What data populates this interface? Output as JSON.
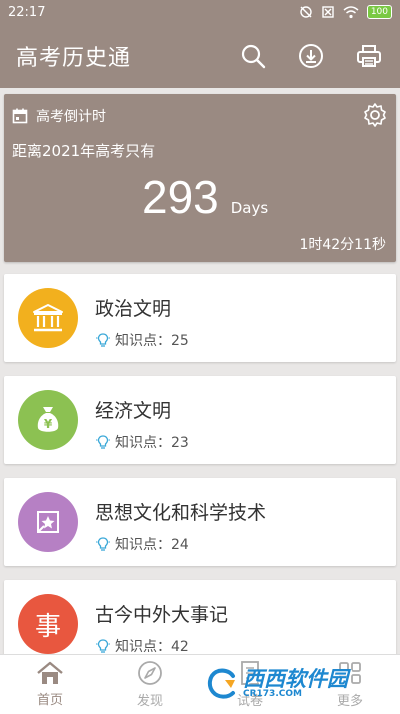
{
  "status_bar": {
    "time": "22:17",
    "battery": "100"
  },
  "app": {
    "title": "高考历史通"
  },
  "countdown": {
    "label": "高考倒计时",
    "subtitle": "距离2021年高考只有",
    "days": "293",
    "unit": "Days",
    "timer": "1时42分11秒"
  },
  "categories": [
    {
      "name": "政治文明",
      "meta": "知识点：25",
      "color": "#f2b01e",
      "icon": "bank-icon"
    },
    {
      "name": "经济文明",
      "meta": "知识点：23",
      "color": "#8cc152",
      "icon": "money-bag-icon"
    },
    {
      "name": "思想文化和科学技术",
      "meta": "知识点：24",
      "color": "#b680c4",
      "icon": "star-picture-icon"
    },
    {
      "name": "古今中外大事记",
      "meta": "知识点：42",
      "color": "#e8573f",
      "icon": "event-icon",
      "icon_char": "事"
    }
  ],
  "nav": [
    {
      "label": "首页",
      "icon": "home-icon",
      "active": true
    },
    {
      "label": "发现",
      "icon": "compass-icon",
      "active": false
    },
    {
      "label": "试卷",
      "icon": "paper-icon",
      "active": false
    },
    {
      "label": "更多",
      "icon": "more-icon",
      "active": false
    }
  ],
  "watermark": {
    "text": "西西软件园",
    "url": "CR173.COM"
  },
  "colors": {
    "brand": "#9a8a82",
    "bulb": "#3aa8d8"
  }
}
